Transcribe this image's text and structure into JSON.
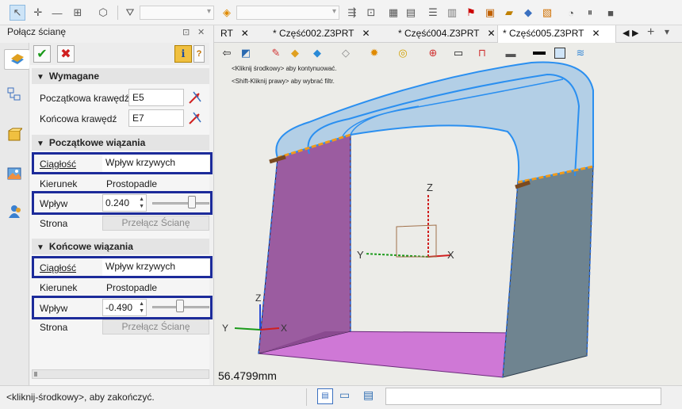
{
  "panel": {
    "title": "Połącz ścianę",
    "sections": {
      "required": {
        "title": "Wymagane",
        "start_edge_label": "Początkowa krawędź",
        "start_edge_value": "E5",
        "end_edge_label": "Końcowa krawędź",
        "end_edge_value": "E7"
      },
      "start_constraints": {
        "title": "Początkowe wiązania",
        "continuity_label": "Ciągłość",
        "continuity_value": "Wpływ krzywych",
        "direction_label": "Kierunek",
        "direction_value": "Prostopadle",
        "influence_label": "Wpływ",
        "influence_value": "0.240",
        "influence_level": 0.72,
        "side_label": "Strona",
        "side_button": "Przełącz Ścianę"
      },
      "end_constraints": {
        "title": "Końcowe wiązania",
        "continuity_label": "Ciągłość",
        "continuity_value": "Wpływ krzywych",
        "direction_label": "Kierunek",
        "direction_value": "Prostopadle",
        "influence_label": "Wpływ",
        "influence_value": "-0.490",
        "influence_level": 0.48,
        "side_label": "Strona",
        "side_button": "Przełącz Ścianę"
      }
    }
  },
  "tabs": [
    {
      "label": "RT",
      "closable": true
    },
    {
      "label": "* Część002.Z3PRT",
      "closable": true
    },
    {
      "label": "* Część004.Z3PRT",
      "closable": true
    },
    {
      "label": "* Część005.Z3PRT",
      "closable": true,
      "active": true
    }
  ],
  "viewport": {
    "hint_1": "<Kliknij środkowy> aby kontynuować.",
    "hint_2": "<Shift-Kliknij prawy> aby wybrać filtr.",
    "measurement": "56.4799mm",
    "axis_labels": {
      "x": "X",
      "y": "Y",
      "z": "Z"
    }
  },
  "status": {
    "text": "<kliknij-środkowy>, aby zakończyć."
  },
  "colors": {
    "highlight_box": "#1c2b9a",
    "face_purple": "#9b5ca0",
    "face_grey": "#6f8490",
    "surface_blue": "#b3cfe6",
    "edge_blue": "#2a8ff0",
    "edge_orange": "#f09a1a",
    "floor_pink": "#cf78d6"
  }
}
